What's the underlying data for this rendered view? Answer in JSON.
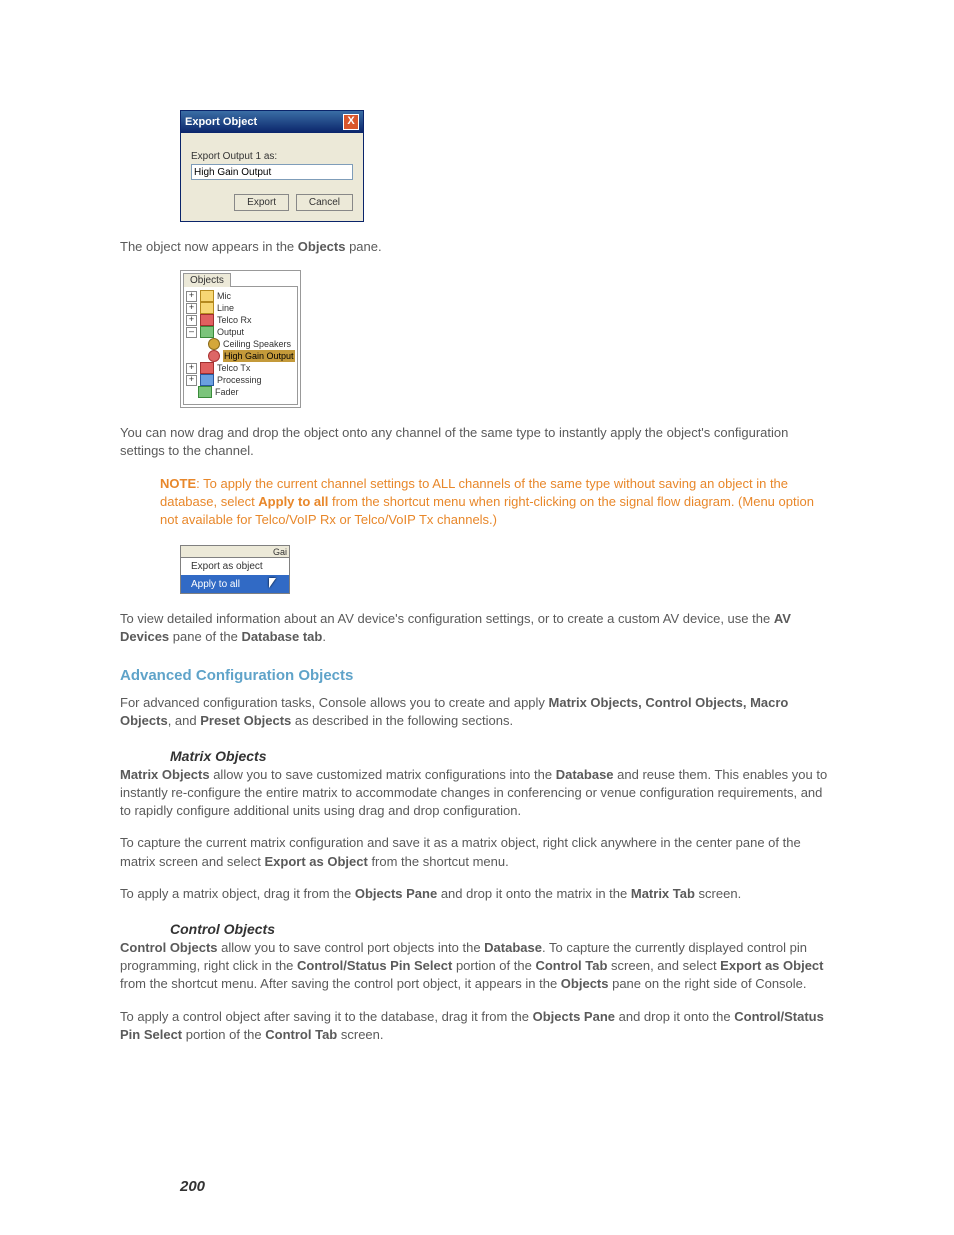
{
  "fig1": {
    "title": "Export Object",
    "label": "Export Output 1 as:",
    "value": "High Gain Output",
    "btn_export": "Export",
    "btn_cancel": "Cancel",
    "close": "X"
  },
  "para1_a": "The object now appears in the ",
  "para1_b": "Objects",
  "para1_c": " pane.",
  "fig2": {
    "tab": "Objects",
    "mic": "Mic",
    "line": "Line",
    "telcorx": "Telco Rx",
    "output": "Output",
    "ceiling": "Ceiling Speakers",
    "highgain": "High Gain Output",
    "telcotx": "Telco Tx",
    "processing": "Processing",
    "fader": "Fader",
    "plus": "+",
    "minus": "–"
  },
  "para2": "You can now drag and drop the object onto any channel of the same type to instantly apply the object's configuration settings to the channel.",
  "note": {
    "label": "NOTE",
    "sep": ":",
    "text_a": " To apply the current channel settings to ALL channels of the same type without saving an object in the database, select ",
    "text_b": "Apply to all",
    "text_c": " from the shortcut menu when right-clicking on the signal flow diagram. (Menu option not available for Telco/VoIP Rx or Telco/VoIP Tx channels.)"
  },
  "fig3": {
    "gai": "Gai",
    "export": "Export as object",
    "apply": "Apply to all"
  },
  "para3_a": "To view detailed information about an AV device's configuration settings, or to create a custom AV device, use the ",
  "para3_b": "AV Devices",
  "para3_c": " pane of the ",
  "para3_d": "Database tab",
  "para3_e": ".",
  "h_adv": "Advanced Configuration Objects",
  "para4_a": "For advanced configuration tasks, Console allows you to create and apply ",
  "para4_b": "Matrix Objects, Control Objects, Macro Objects",
  "para4_c": ", and ",
  "para4_d": "Preset Objects",
  "para4_e": " as described in the following sections.",
  "h_matrix": "Matrix Objects",
  "para5_a": "Matrix Objects",
  "para5_b": " allow you to save customized matrix configurations into the ",
  "para5_c": "Database",
  "para5_d": " and reuse them. This enables you to instantly re-configure the entire matrix to accommodate changes in conferencing or venue configuration requirements, and to rapidly configure additional units using drag and drop configuration.",
  "para6_a": "To capture the current matrix configuration and save it as a matrix object, right click anywhere in the center pane of the matrix screen and select ",
  "para6_b": "Export as Object",
  "para6_c": " from the shortcut menu.",
  "para7_a": "To apply a matrix object, drag it from the ",
  "para7_b": "Objects Pane",
  "para7_c": " and drop it onto the matrix in the ",
  "para7_d": "Matrix Tab",
  "para7_e": " screen.",
  "h_control": "Control Objects",
  "para8_a": "Control Objects",
  "para8_b": " allow you to save control port objects into the ",
  "para8_c": "Database",
  "para8_d": ". To capture the currently displayed control pin programming, right click in the ",
  "para8_e": "Control/Status Pin Select",
  "para8_f": " portion of the ",
  "para8_g": "Control Tab",
  "para8_h": " screen, and select ",
  "para8_i": "Export as Object",
  "para8_j": " from the shortcut menu. After saving the control port object, it appears in the ",
  "para8_k": "Objects",
  "para8_l": " pane on the right side of Console.",
  "para9_a": "To apply a control object after saving it to the database, drag it from the ",
  "para9_b": "Objects Pane",
  "para9_c": " and drop it onto the ",
  "para9_d": "Control/Status Pin Select",
  "para9_e": " portion of the ",
  "para9_f": "Control Tab",
  "para9_g": " screen.",
  "page_num": "200"
}
